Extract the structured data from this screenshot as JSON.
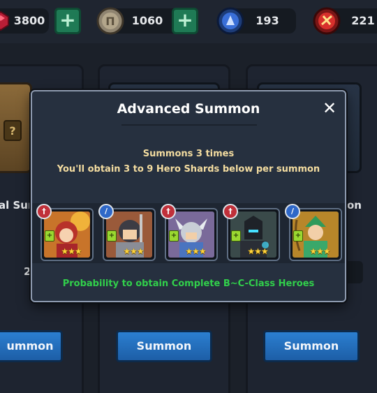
{
  "resources": [
    {
      "name": "ruby",
      "value": "3800",
      "icon": "ruby-icon",
      "has_plus": true,
      "color": "#c0203a"
    },
    {
      "name": "coin",
      "value": "1060",
      "icon": "coin-icon",
      "has_plus": true,
      "color": "#b9a98a"
    },
    {
      "name": "blue-ticket",
      "value": "193",
      "icon": "blue-summon-ticket-icon",
      "has_plus": false,
      "color": "#3a6fd8"
    },
    {
      "name": "red-ticket",
      "value": "221",
      "icon": "red-summon-ticket-icon",
      "has_plus": false,
      "color": "#d8302c"
    }
  ],
  "background_panels": {
    "left_label": "al Sur",
    "right_label": "on",
    "left_cost": "2",
    "buttons": [
      "ummon",
      "Summon",
      "Summon"
    ]
  },
  "modal": {
    "title": "Advanced Summon",
    "close_icon": "close-icon",
    "line1": "Summons 3 times",
    "line2": "You'll obtain 3 to 9 Hero Shards below per summon",
    "probability": "Probability to obtain Complete B~C-Class Heroes",
    "heroes": [
      {
        "name": "red-haired-hero",
        "class_icon": "sword-class-icon",
        "class_color": "#c0303a",
        "stars": 3,
        "bg": "#c8742a"
      },
      {
        "name": "knight-hero",
        "class_icon": "staff-class-icon",
        "class_color": "#2f68c8",
        "stars": 3,
        "bg": "#9a5a3a"
      },
      {
        "name": "winged-helm-hero",
        "class_icon": "sword-class-icon",
        "class_color": "#c0303a",
        "stars": 3,
        "bg": "#7a6a9a"
      },
      {
        "name": "dark-knight-hero",
        "class_icon": "sword-class-icon",
        "class_color": "#c0303a",
        "stars": 3,
        "bg": "#3a4a4a"
      },
      {
        "name": "green-archer-hero",
        "class_icon": "staff-class-icon",
        "class_color": "#2f68c8",
        "stars": 3,
        "bg": "#b8862a"
      }
    ]
  }
}
